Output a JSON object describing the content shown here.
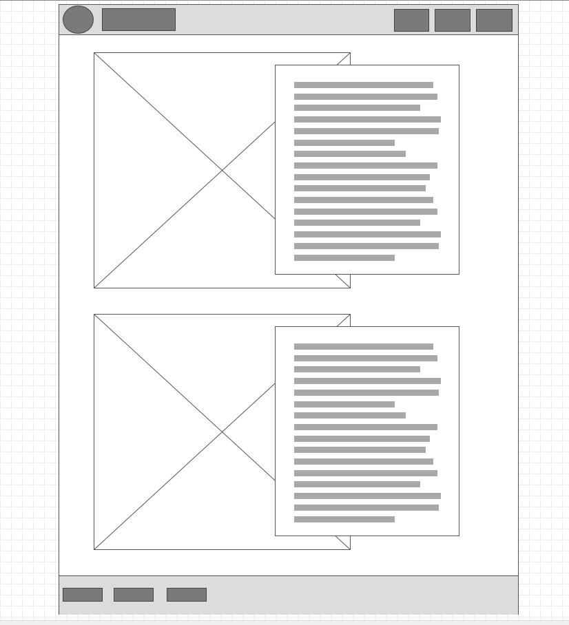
{
  "header": {
    "logo_icon": "circle-logo-placeholder",
    "title_placeholder": "title-bar-placeholder",
    "nav_count": 3
  },
  "sections": [
    {
      "image_icon": "image-placeholder-cross-icon",
      "text_line_fractions": [
        0.75,
        0.77,
        0.68,
        0.79,
        0.78,
        0.54,
        0.6,
        0.77,
        0.73,
        0.71,
        0.75,
        0.77,
        0.68,
        0.79,
        0.78,
        0.54
      ]
    },
    {
      "image_icon": "image-placeholder-cross-icon",
      "text_line_fractions": [
        0.75,
        0.77,
        0.68,
        0.79,
        0.78,
        0.54,
        0.6,
        0.77,
        0.73,
        0.71,
        0.75,
        0.77,
        0.68,
        0.79,
        0.78,
        0.54
      ]
    }
  ],
  "footer": {
    "button_count": 3
  },
  "colors": {
    "chrome": "#dcdcdc",
    "placeholder_fill": "#7a7a7a",
    "text_line": "#a8a8a8",
    "border": "#555555"
  }
}
